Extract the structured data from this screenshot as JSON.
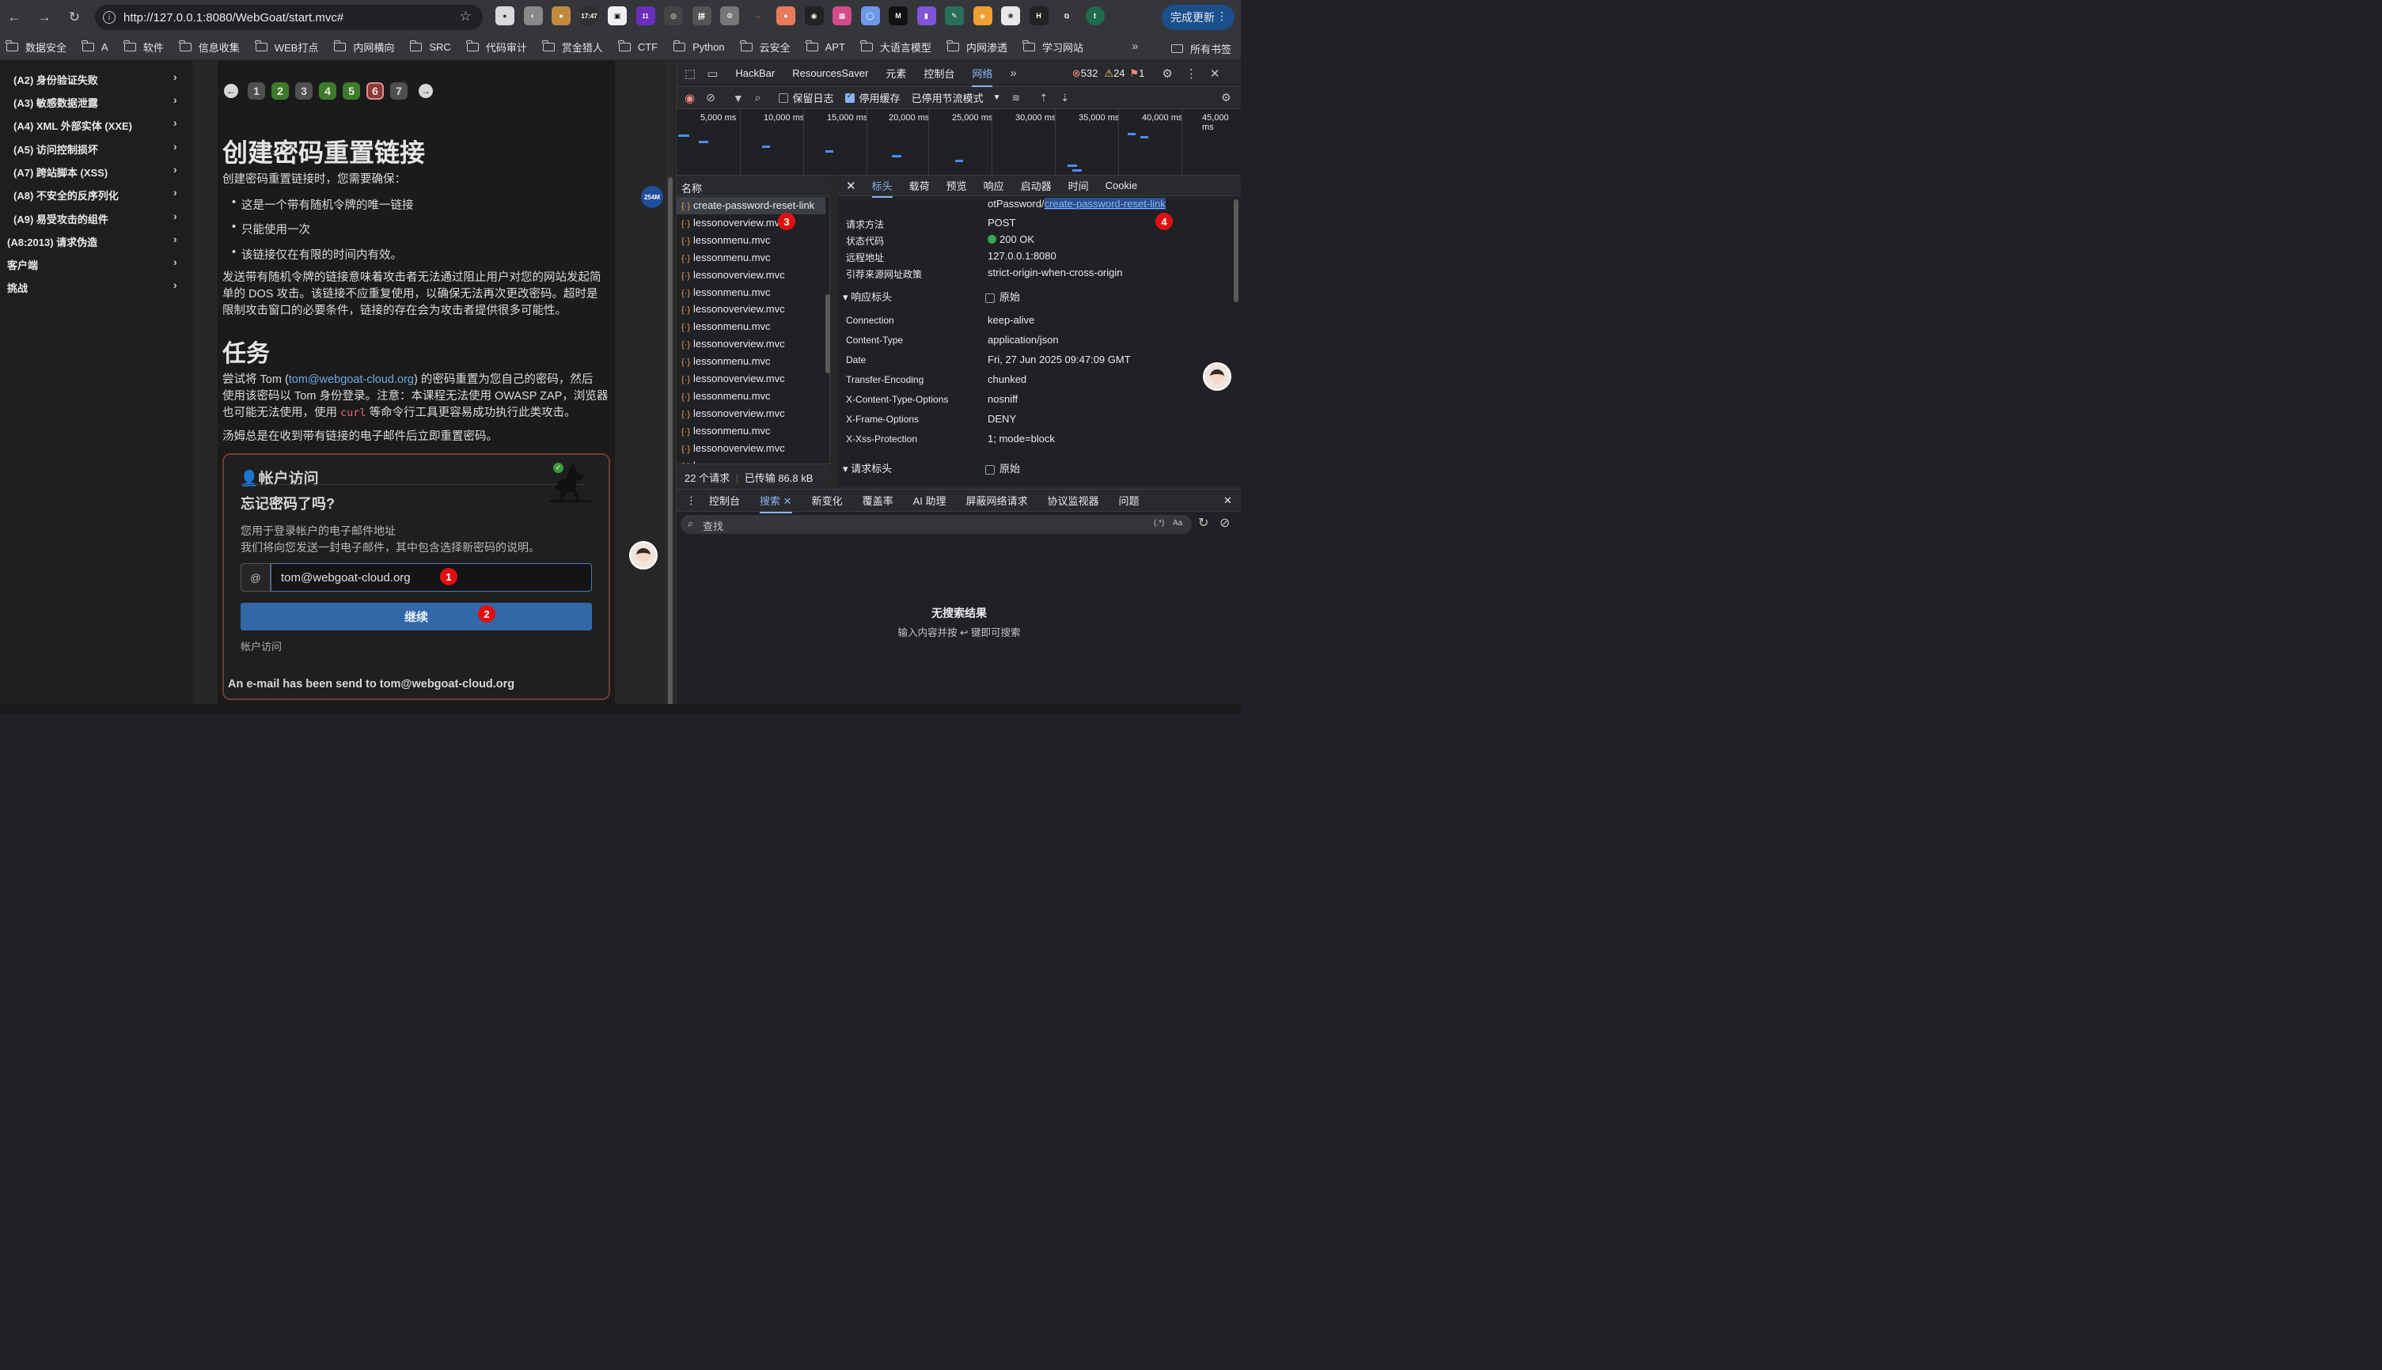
{
  "browser": {
    "url": "http://127.0.0.1:8080/WebGoat/start.mvc#",
    "clock": "17:47",
    "badge_count": "11",
    "update_button": "完成更新",
    "bookmarks": [
      "数据安全",
      "A",
      "软件",
      "信息收集",
      "WEB打点",
      "内网横向",
      "SRC",
      "代码审计",
      "赏金猎人",
      "CTF",
      "Python",
      "云安全",
      "APT",
      "大语言模型",
      "内网渗透",
      "学习网站"
    ],
    "all_bookmarks": "所有书签"
  },
  "sidebar": {
    "items": [
      "(A2) 身份验证失败",
      "(A3) 敏感数据泄露",
      "(A4) XML 外部实体 (XXE)",
      "(A5) 访问控制损坏",
      "(A7) 跨站脚本 (XSS)",
      "(A8) 不安全的反序列化",
      "(A9) 易受攻击的组件",
      "(A8:2013) 请求伪造",
      "客户端",
      "挑战"
    ]
  },
  "lesson": {
    "pages": [
      "1",
      "2",
      "3",
      "4",
      "5",
      "6",
      "7"
    ],
    "title": "创建密码重置链接",
    "intro": "创建密码重置链接时，您需要确保：",
    "bullets": [
      "这是一个带有随机令牌的唯一链接",
      "只能使用一次",
      "该链接仅在有限的时间内有效。"
    ],
    "para1_l1": "发送带有随机令牌的链接意味着攻击者无法通过阻止用户对您的网站发起简",
    "para1_l2": "单的 DOS 攻击。该链接不应重复使用，以确保无法再次更改密码。超时是",
    "para1_l3": "限制攻击窗口的必要条件，链接的存在会为攻击者提供很多可能性。",
    "task_title": "任务",
    "task_l1_a": "尝试将 Tom (",
    "task_email": "tom@webgoat-cloud.org",
    "task_l1_b": ") 的密码重置为您自己的密码，然后",
    "task_l2": "使用该密码以 Tom 身份登录。注意：本课程无法使用 OWASP ZAP，浏览器",
    "task_l3_a": "也可能无法使用，使用",
    "task_code": "curl",
    "task_l3_b": "等命令行工具更容易成功执行此类攻击。",
    "note": "汤姆总是在收到带有链接的电子邮件后立即重置密码。",
    "card": {
      "title": "帐户访问",
      "subtitle": "忘记密码了吗?",
      "desc1": "您用于登录帐户的电子邮件地址",
      "desc2": "我们将向您发送一封电子邮件，其中包含选择新密码的说明。",
      "at": "@",
      "email_value": "tom@webgoat-cloud.org",
      "button": "继续",
      "account_link": "帐户访问",
      "message": "An e-mail has been send to tom@webgoat-cloud.org"
    }
  },
  "annotations": [
    "1",
    "2",
    "3",
    "4"
  ],
  "memory": "254M",
  "devtools": {
    "tabs": [
      "HackBar",
      "ResourcesSaver",
      "元素",
      "控制台",
      "网络"
    ],
    "errors": "532",
    "warnings": "24",
    "issues": "1",
    "toolbar": {
      "preserve_log": "保留日志",
      "disable_cache": "停用缓存",
      "throttle": "已停用节流模式"
    },
    "timeline": [
      "5,000 ms",
      "10,000 ms",
      "15,000 ms",
      "20,000 ms",
      "25,000 ms",
      "30,000 ms",
      "35,000 ms",
      "40,000 ms",
      "45,000 ms"
    ],
    "name_header": "名称",
    "requests": [
      "create-password-reset-link",
      "lessonoverview.mvc",
      "lessonmenu.mvc",
      "lessonmenu.mvc",
      "lessonoverview.mvc",
      "lessonmenu.mvc",
      "lessonoverview.mvc",
      "lessonmenu.mvc",
      "lessonoverview.mvc",
      "lessonmenu.mvc",
      "lessonoverview.mvc",
      "lessonmenu.mvc",
      "lessonoverview.mvc",
      "lessonmenu.mvc",
      "lessonoverview.mvc",
      "lessonmenu.mvc"
    ],
    "summary_requests": "22 个请求",
    "summary_transferred": "已传输 86.8 kB",
    "detail_tabs": [
      "标头",
      "载荷",
      "预览",
      "响应",
      "启动器",
      "时间",
      "Cookie"
    ],
    "url_prefix": "otPassword/",
    "url_highlight": "create-password-reset-link",
    "general": [
      {
        "k": "请求方法",
        "v": "POST"
      },
      {
        "k": "状态代码",
        "v": "200 OK"
      },
      {
        "k": "远程地址",
        "v": "127.0.0.1:8080"
      },
      {
        "k": "引荐来源网址政策",
        "v": "strict-origin-when-cross-origin"
      }
    ],
    "response_headers_title": "▾ 响应标头",
    "raw": "原始",
    "response_headers": [
      {
        "k": "Connection",
        "v": "keep-alive"
      },
      {
        "k": "Content-Type",
        "v": "application/json"
      },
      {
        "k": "Date",
        "v": "Fri, 27 Jun 2025 09:47:09 GMT"
      },
      {
        "k": "Transfer-Encoding",
        "v": "chunked"
      },
      {
        "k": "X-Content-Type-Options",
        "v": "nosniff"
      },
      {
        "k": "X-Frame-Options",
        "v": "DENY"
      },
      {
        "k": "X-Xss-Protection",
        "v": "1; mode=block"
      }
    ],
    "request_headers_title": "▾ 请求标头",
    "drawer_tabs": [
      "控制台",
      "搜索",
      "新变化",
      "覆盖率",
      "AI 助理",
      "屏蔽网络请求",
      "协议监视器",
      "问题"
    ],
    "search_placeholder": "查找",
    "regex": "(.*)",
    "case": "Aa",
    "empty_title": "无搜索结果",
    "empty_hint": "输入内容并按 ↩ 键即可搜索"
  }
}
